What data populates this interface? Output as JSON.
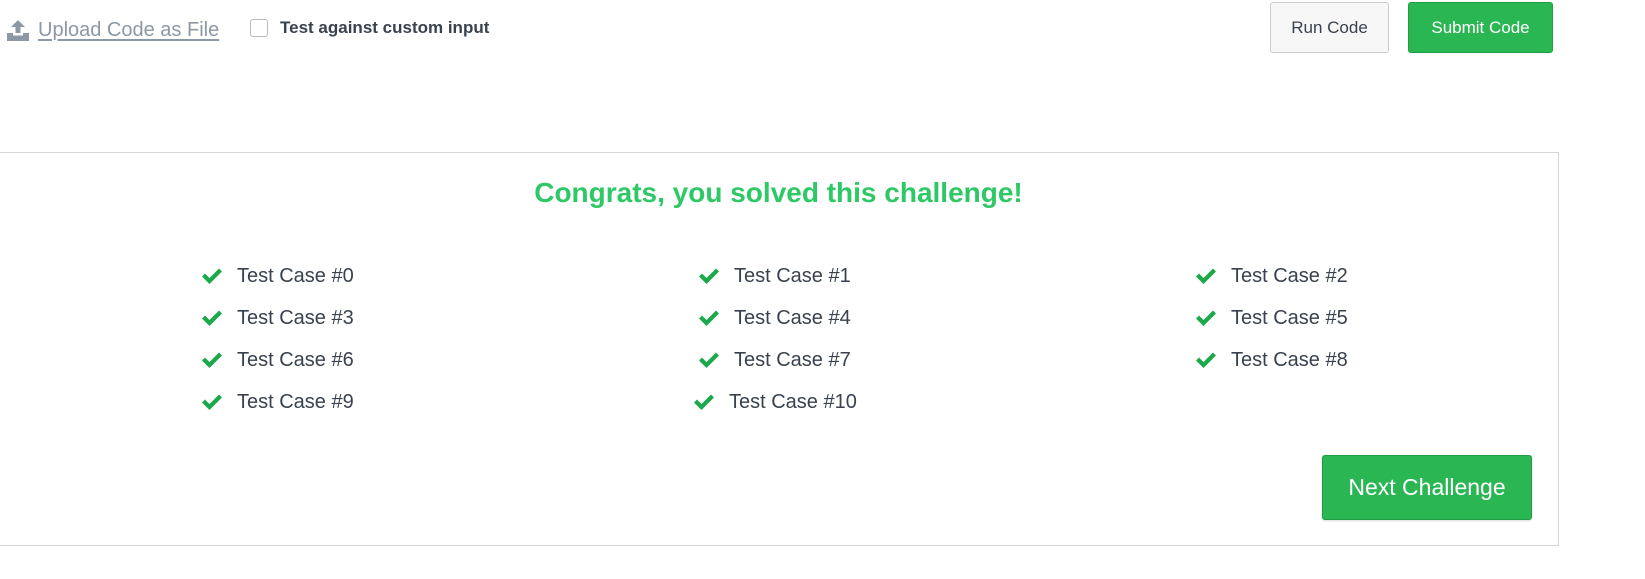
{
  "toolbar": {
    "upload_label": "Upload Code as File",
    "upload_icon": "upload-icon",
    "custom_input_label": "Test against custom input",
    "custom_input_checked": false,
    "run_label": "Run Code",
    "submit_label": "Submit Code"
  },
  "result": {
    "message": "Congrats, you solved this challenge!",
    "test_cases": [
      {
        "label": "Test Case #0",
        "status": "passed"
      },
      {
        "label": "Test Case #1",
        "status": "passed"
      },
      {
        "label": "Test Case #2",
        "status": "passed"
      },
      {
        "label": "Test Case #3",
        "status": "passed"
      },
      {
        "label": "Test Case #4",
        "status": "passed"
      },
      {
        "label": "Test Case #5",
        "status": "passed"
      },
      {
        "label": "Test Case #6",
        "status": "passed"
      },
      {
        "label": "Test Case #7",
        "status": "passed"
      },
      {
        "label": "Test Case #8",
        "status": "passed"
      },
      {
        "label": "Test Case #9",
        "status": "passed"
      },
      {
        "label": "Test Case #10",
        "status": "passed"
      }
    ],
    "next_label": "Next Challenge"
  },
  "colors": {
    "success": "#2ec866",
    "check": "#1ba94c",
    "button_green": "#2ab653",
    "link_gray": "#8c98a4",
    "text": "#39424e"
  }
}
